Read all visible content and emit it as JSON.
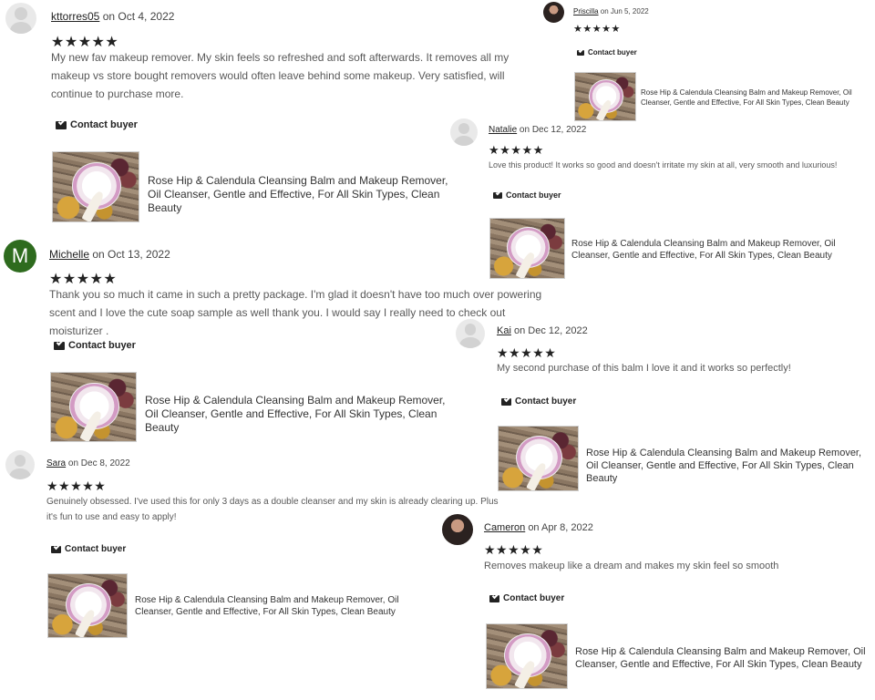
{
  "product_title": "Rose Hip & Calendula Cleansing Balm and Makeup Remover, Oil Cleanser, Gentle and Effective, For All Skin Types, Clean Beauty",
  "contact_label": "Contact buyer",
  "reviews": [
    {
      "user": "kttorres05",
      "date": "on Oct 4, 2022",
      "stars": "★★★★★",
      "text": "My new fav makeup remover. My skin feels so refreshed and soft afterwards. It removes all my makeup vs store bought removers would often leave behind some makeup. Very satisfied, will continue to purchase more."
    },
    {
      "user": "Priscilla",
      "date": "on Jun 5, 2022",
      "stars": "★★★★★",
      "text": ""
    },
    {
      "user": "Natalie",
      "date": "on Dec 12, 2022",
      "stars": "★★★★★",
      "text": "Love this product! It works so good and doesn't irritate my skin at all, very smooth and luxurious!"
    },
    {
      "user": "Michelle",
      "avatar_letter": "M",
      "date": "on Oct 13, 2022",
      "stars": "★★★★★",
      "text": "Thank you so much it came in such a pretty package. I'm glad it doesn't have too much over powering scent and I love the cute soap sample as well thank you. I would say I really need to check out moisturizer ."
    },
    {
      "user": "Kai",
      "date": "on Dec 12, 2022",
      "stars": "★★★★★",
      "text": "My second purchase of this balm I love it and it works so perfectly!"
    },
    {
      "user": "Sara",
      "date": "on Dec 8, 2022",
      "stars": "★★★★★",
      "text": "Genuinely obsessed. I've used this for only 3 days as a double cleanser and my skin is already clearing up. Plus it's fun to use and easy to apply!"
    },
    {
      "user": "Cameron",
      "date": "on Apr 8, 2022",
      "stars": "★★★★★",
      "text": "Removes makeup like a dream and makes my skin feel so smooth"
    }
  ],
  "colors": {
    "avatar_letter_bg": "#2e6b1e",
    "text": "#595959",
    "link": "#222222"
  },
  "icons": {
    "contact": "envelope-icon",
    "avatar": "user-avatar-icon",
    "thumb": "product-thumbnail"
  }
}
